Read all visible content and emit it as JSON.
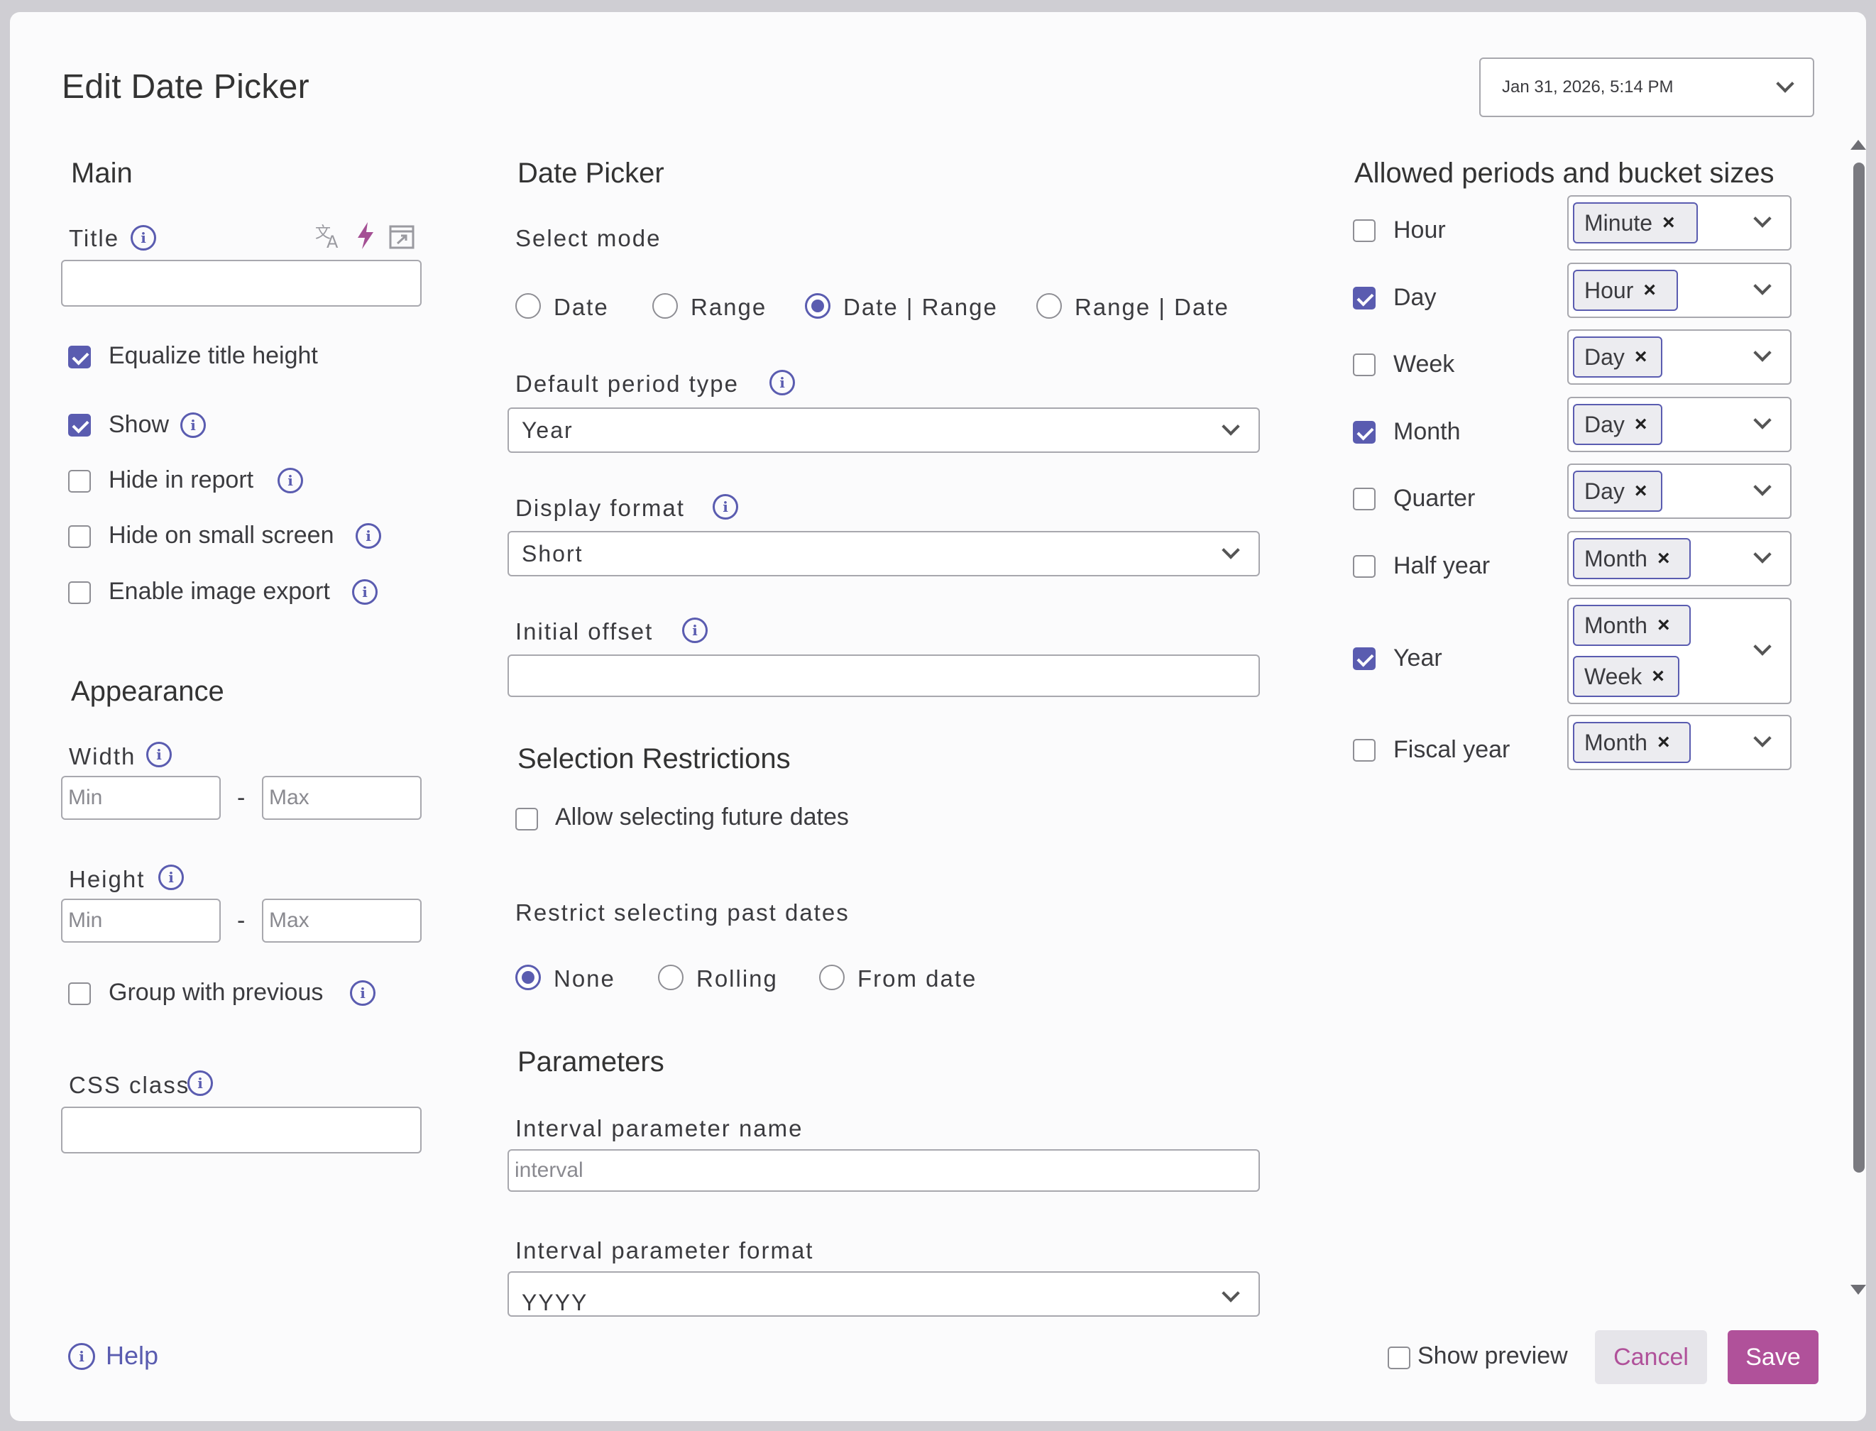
{
  "dialog": {
    "title": "Edit Date Picker",
    "date_select": "Jan 31, 2026, 5:14 PM"
  },
  "main": {
    "heading": "Main",
    "title_label": "Title",
    "title_value": "",
    "checks": [
      {
        "label": "Equalize title height",
        "checked": true
      },
      {
        "label": "Show",
        "checked": true
      },
      {
        "label": "Hide in report",
        "checked": false
      },
      {
        "label": "Hide on small screen",
        "checked": false
      },
      {
        "label": "Enable image export",
        "checked": false
      }
    ]
  },
  "appearance": {
    "heading": "Appearance",
    "width_label": "Width",
    "height_label": "Height",
    "min_placeholder": "Min",
    "max_placeholder": "Max",
    "dash": "-",
    "group_label": "Group with previous",
    "css_label": "CSS class"
  },
  "date_picker": {
    "heading": "Date Picker",
    "select_mode_label": "Select mode",
    "modes": [
      {
        "label": "Date",
        "selected": false
      },
      {
        "label": "Range",
        "selected": false
      },
      {
        "label": "Date | Range",
        "selected": true
      },
      {
        "label": "Range | Date",
        "selected": false
      }
    ],
    "default_period_label": "Default period type",
    "default_period_value": "Year",
    "display_format_label": "Display format",
    "display_format_value": "Short",
    "initial_offset_label": "Initial offset",
    "initial_offset_value": ""
  },
  "restrictions": {
    "heading": "Selection Restrictions",
    "future_label": "Allow selecting future dates",
    "past_label": "Restrict selecting past dates",
    "past_options": [
      {
        "label": "None",
        "selected": true
      },
      {
        "label": "Rolling",
        "selected": false
      },
      {
        "label": "From date",
        "selected": false
      }
    ]
  },
  "parameters": {
    "heading": "Parameters",
    "interval_name_label": "Interval parameter name",
    "interval_name_placeholder": "interval",
    "interval_format_label": "Interval parameter format",
    "interval_format_value": "YYYY"
  },
  "periods": {
    "heading": "Allowed periods and bucket sizes",
    "rows": [
      {
        "label": "Hour",
        "checked": false,
        "chips": [
          "Minute"
        ]
      },
      {
        "label": "Day",
        "checked": true,
        "chips": [
          "Hour"
        ]
      },
      {
        "label": "Week",
        "checked": false,
        "chips": [
          "Day"
        ]
      },
      {
        "label": "Month",
        "checked": true,
        "chips": [
          "Day"
        ]
      },
      {
        "label": "Quarter",
        "checked": false,
        "chips": [
          "Day"
        ]
      },
      {
        "label": "Half year",
        "checked": false,
        "chips": [
          "Month"
        ]
      },
      {
        "label": "Year",
        "checked": true,
        "chips": [
          "Month",
          "Week"
        ]
      },
      {
        "label": "Fiscal year",
        "checked": false,
        "chips": [
          "Month"
        ]
      }
    ]
  },
  "footer": {
    "help": "Help",
    "show_preview": "Show preview",
    "cancel": "Cancel",
    "save": "Save"
  },
  "colors": {
    "accent": "#5a5cb0",
    "save_bg": "#b0519a",
    "cancel_text": "#b0519a"
  }
}
